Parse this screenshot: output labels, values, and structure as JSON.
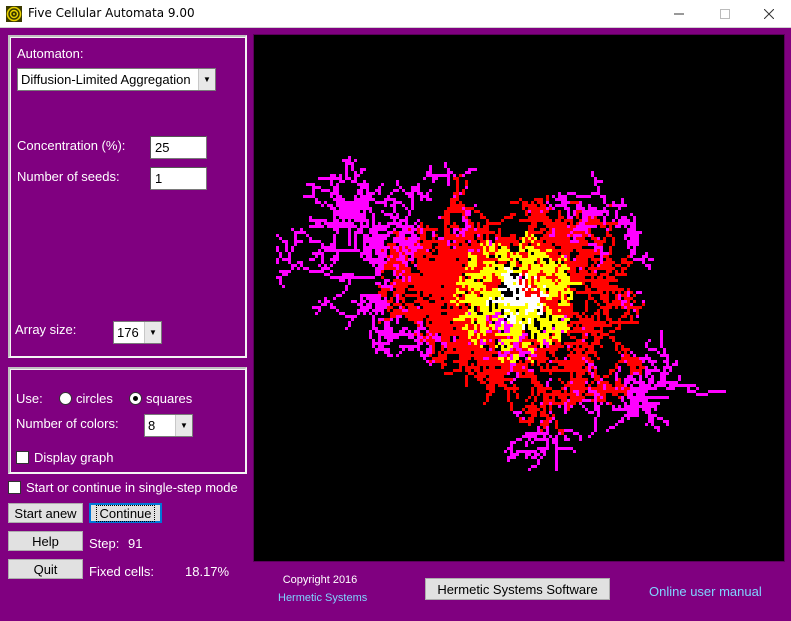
{
  "window": {
    "title": "Five Cellular Automata 9.00"
  },
  "controls": {
    "automaton_label": "Automaton:",
    "automaton_value": "Diffusion-Limited Aggregation",
    "concentration_label": "Concentration (%):",
    "concentration_value": "25",
    "seeds_label": "Number of seeds:",
    "seeds_value": "1",
    "array_size_label": "Array size:",
    "array_size_value": "176",
    "use_label": "Use:",
    "use_options": [
      "circles",
      "squares"
    ],
    "use_selected": "squares",
    "colors_label": "Number of colors:",
    "colors_value": "8",
    "display_graph_label": "Display graph",
    "display_graph_checked": false,
    "single_step_label": "Start or continue in single-step mode",
    "single_step_checked": false
  },
  "buttons": {
    "start_anew": "Start anew",
    "continue": "Continue",
    "help": "Help",
    "quit": "Quit",
    "hermetic": "Hermetic Systems Software"
  },
  "status": {
    "step_label": "Step:",
    "step_value": "91",
    "fixed_label": "Fixed cells:",
    "fixed_value": "18.17%"
  },
  "footer": {
    "copyright": "Copyright 2016",
    "company": "Hermetic Systems",
    "manual": "Online user manual"
  },
  "colors": {
    "background": "#800080",
    "cluster_core": "#ffffff",
    "cluster_inner": "#ffff00",
    "cluster_outer": "#ff0000",
    "cluster_tips": "#ff00ff"
  }
}
